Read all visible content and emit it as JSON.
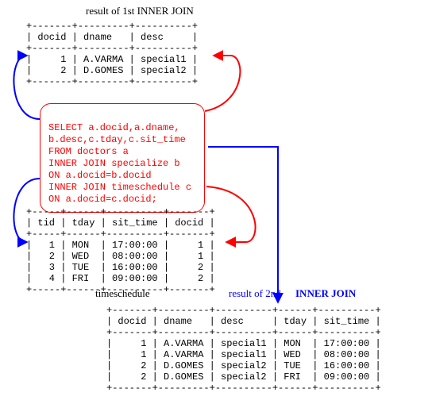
{
  "labels": {
    "table1_title": "result of 1st INNER JOIN",
    "table3_title": "timeschedule",
    "table4_title_a": "result of 2nd",
    "table4_title_b": "INNER JOIN"
  },
  "query": {
    "l1": "SELECT a.docid,a.dname,",
    "l2": "b.desc,c.tday,c.sit_time",
    "l3": "FROM doctors a",
    "l4": "INNER JOIN specialize b",
    "l5": "ON a.docid=b.docid",
    "l6": "INNER JOIN timeschedule c",
    "l7": "ON a.docid=c.docid;"
  },
  "table1": {
    "columns": [
      "docid",
      "dname",
      "desc"
    ],
    "rows": [
      {
        "docid": "1",
        "dname": "A.VARMA",
        "desc": "special1"
      },
      {
        "docid": "2",
        "dname": "D.GOMES",
        "desc": "special2"
      }
    ]
  },
  "table3": {
    "columns": [
      "tid",
      "tday",
      "sit_time",
      "docid"
    ],
    "rows": [
      {
        "tid": "1",
        "tday": "MON",
        "sit_time": "17:00:00",
        "docid": "1"
      },
      {
        "tid": "2",
        "tday": "WED",
        "sit_time": "08:00:00",
        "docid": "1"
      },
      {
        "tid": "3",
        "tday": "TUE",
        "sit_time": "16:00:00",
        "docid": "2"
      },
      {
        "tid": "4",
        "tday": "FRI",
        "sit_time": "09:00:00",
        "docid": "2"
      }
    ]
  },
  "table4": {
    "columns": [
      "docid",
      "dname",
      "desc",
      "tday",
      "sit_time"
    ],
    "rows": [
      {
        "docid": "1",
        "dname": "A.VARMA",
        "desc": "special1",
        "tday": "MON",
        "sit_time": "17:00:00"
      },
      {
        "docid": "1",
        "dname": "A.VARMA",
        "desc": "special1",
        "tday": "WED",
        "sit_time": "08:00:00"
      },
      {
        "docid": "2",
        "dname": "D.GOMES",
        "desc": "special2",
        "tday": "TUE",
        "sit_time": "16:00:00"
      },
      {
        "docid": "2",
        "dname": "D.GOMES",
        "desc": "special2",
        "tday": "FRI",
        "sit_time": "09:00:00"
      }
    ]
  },
  "chart_data": {
    "type": "table",
    "tables": [
      {
        "name": "result of 1st INNER JOIN",
        "columns": [
          "docid",
          "dname",
          "desc"
        ],
        "rows": [
          [
            1,
            "A.VARMA",
            "special1"
          ],
          [
            2,
            "D.GOMES",
            "special2"
          ]
        ]
      },
      {
        "name": "timeschedule",
        "columns": [
          "tid",
          "tday",
          "sit_time",
          "docid"
        ],
        "rows": [
          [
            1,
            "MON",
            "17:00:00",
            1
          ],
          [
            2,
            "WED",
            "08:00:00",
            1
          ],
          [
            3,
            "TUE",
            "16:00:00",
            2
          ],
          [
            4,
            "FRI",
            "09:00:00",
            2
          ]
        ]
      },
      {
        "name": "result of 2nd INNER JOIN",
        "columns": [
          "docid",
          "dname",
          "desc",
          "tday",
          "sit_time"
        ],
        "rows": [
          [
            1,
            "A.VARMA",
            "special1",
            "MON",
            "17:00:00"
          ],
          [
            1,
            "A.VARMA",
            "special1",
            "WED",
            "08:00:00"
          ],
          [
            2,
            "D.GOMES",
            "special2",
            "TUE",
            "16:00:00"
          ],
          [
            2,
            "D.GOMES",
            "special2",
            "FRI",
            "09:00:00"
          ]
        ]
      }
    ],
    "query": "SELECT a.docid,a.dname, b.desc,c.tday,c.sit_time FROM doctors a INNER JOIN specialize b ON a.docid=b.docid INNER JOIN timeschedule c ON a.docid=c.docid;"
  }
}
